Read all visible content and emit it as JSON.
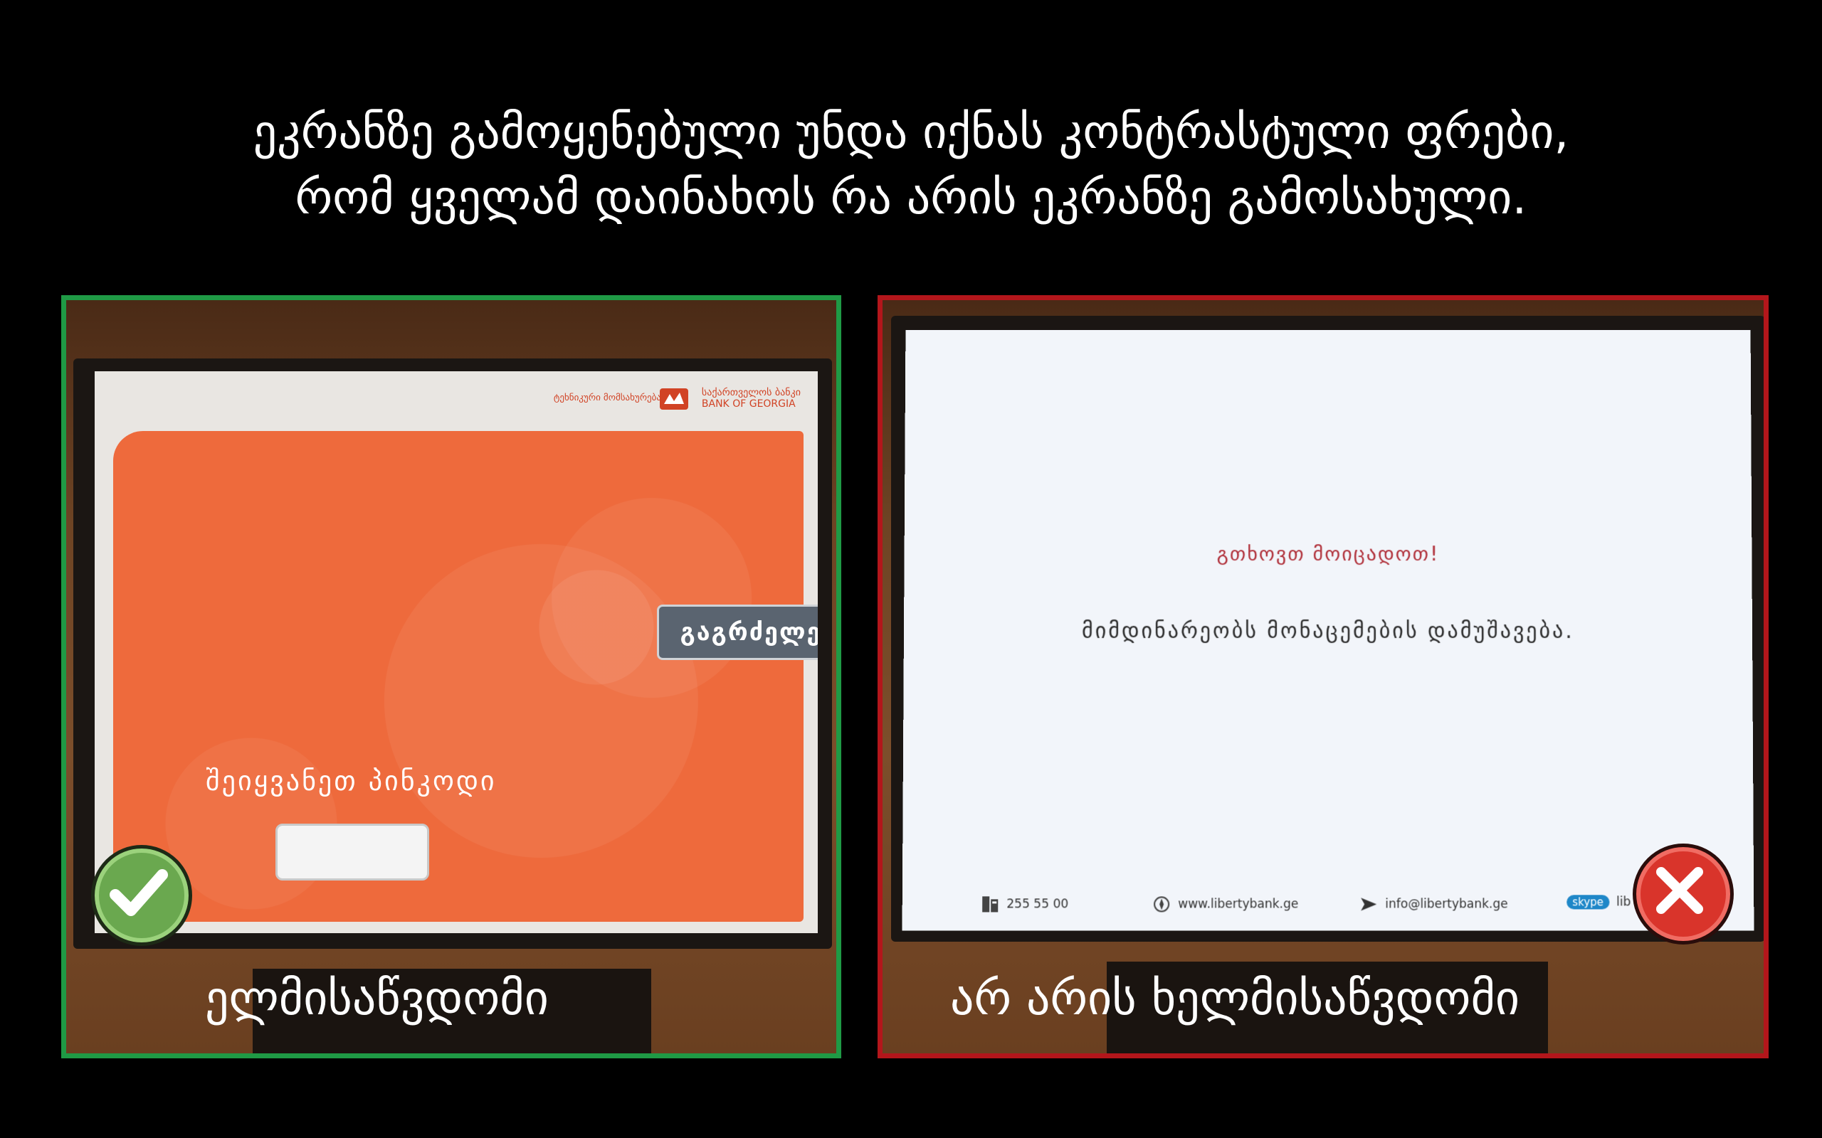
{
  "heading": {
    "line1": "ეკრანზე გამოყენებული უნდა იქნას კონტრასტული ფრები,",
    "line2": "რომ ყველამ დაინახოს რა არის ეკრანზე გამოსახული."
  },
  "left_panel": {
    "caption": "ელმისაწვდომი",
    "badge_icon": "checkmark-icon",
    "border_color": "#1f9a45",
    "atm": {
      "bank_tagline": "ტეხნიკური მომსახურება",
      "bank_name_ka": "საქართველოს ბანკი",
      "bank_name_en": "BANK OF GEORGIA",
      "continue_button": "გაგრძელება",
      "pin_label": "შეიყვანეთ პინკოდი",
      "pin_value": "",
      "accent_color": "#ee6a3c"
    }
  },
  "right_panel": {
    "caption": "არ არის ხელმისაწვდომი",
    "badge_icon": "close-x-icon",
    "border_color": "#b3161b",
    "atm": {
      "message_title": "გთხოვთ მოიცადოთ!",
      "message_body": "მიმდინარეობს მონაცემების დამუშავება.",
      "phone": "255 55 00",
      "website": "www.libertybank.ge",
      "email": "info@libertybank.ge",
      "skype_label": "skype",
      "skype_value": "lib"
    }
  }
}
